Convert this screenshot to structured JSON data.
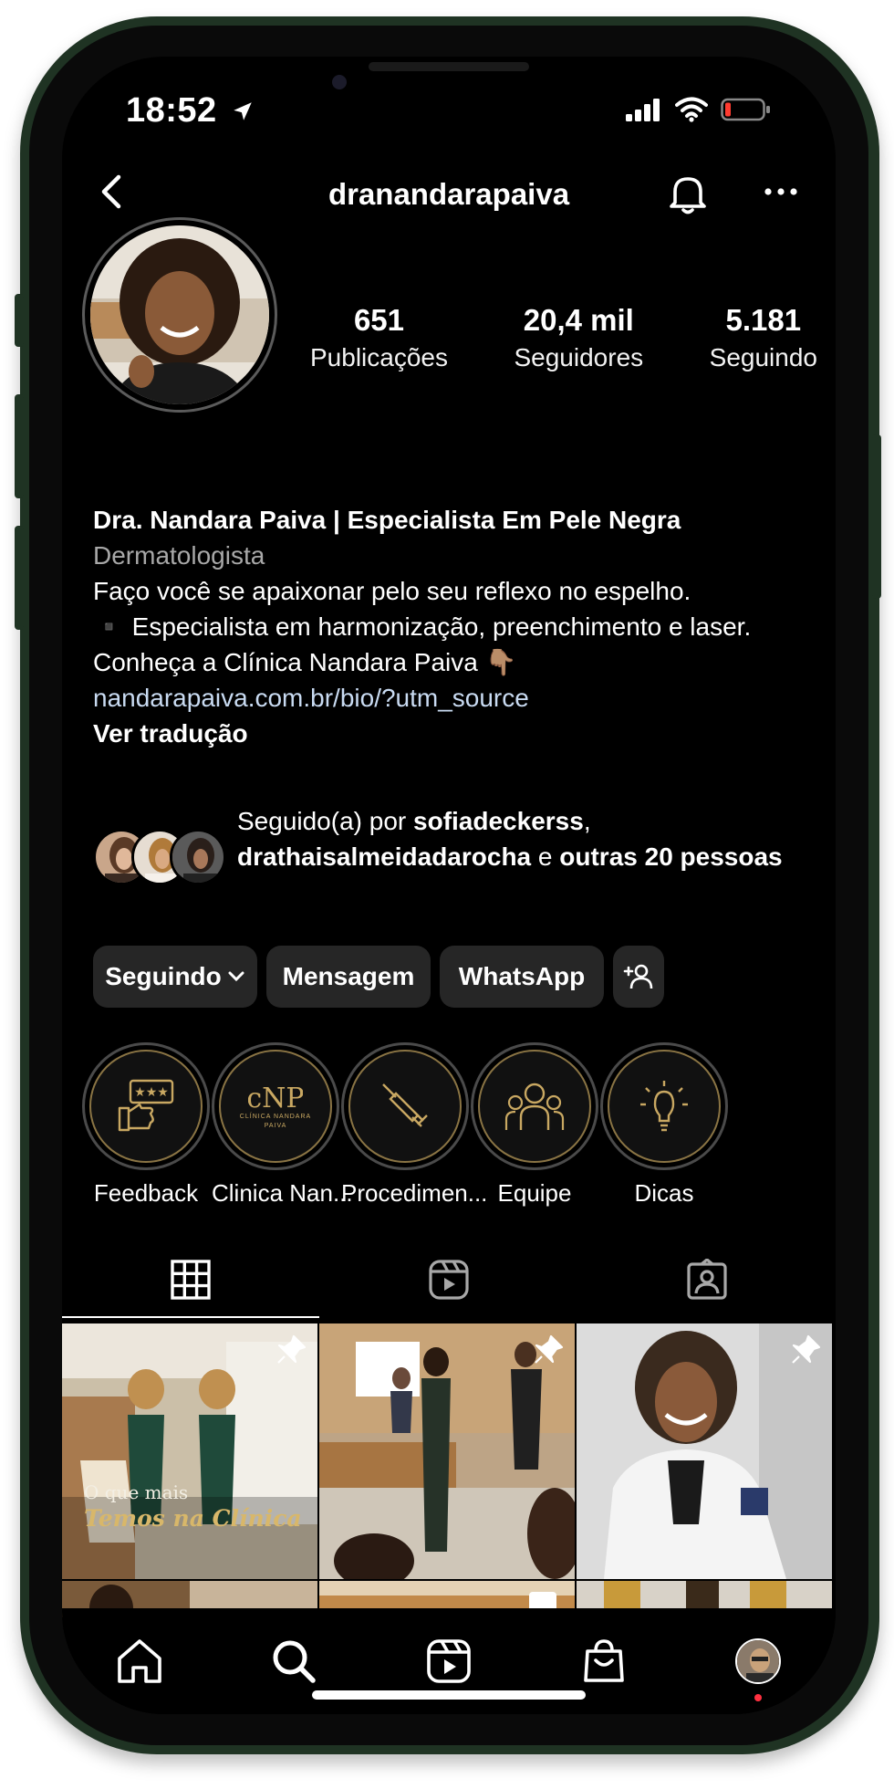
{
  "status_bar": {
    "time": "18:52"
  },
  "header": {
    "username": "dranandarapaiva"
  },
  "stats": [
    {
      "value": "651",
      "label": "Publicações"
    },
    {
      "value": "20,4 mil",
      "label": "Seguidores"
    },
    {
      "value": "5.181",
      "label": "Seguindo"
    }
  ],
  "bio": {
    "name": "Dra. Nandara Paiva | Especialista Em Pele Negra",
    "category": "Dermatologista",
    "line1": "Faço você se apaixonar pelo seu reflexo no espelho.",
    "line2": "▪️ Especialista em harmonização, preenchimento e laser.",
    "line3": "Conheça a Clínica Nandara Paiva 👇🏽",
    "link": "nandarapaiva.com.br/bio/?utm_source",
    "translate": "Ver tradução"
  },
  "followed_by": {
    "prefix": "Seguido(a) por ",
    "user1": "sofiadeckerss",
    "sep": ",",
    "user2": "drathaisalmeidadarocha",
    "connector": " e ",
    "others": "outras 20 pessoas"
  },
  "actions": {
    "following": "Seguindo",
    "message": "Mensagem",
    "whatsapp": "WhatsApp"
  },
  "highlights": [
    {
      "label": "Feedback",
      "icon": "feedback-icon"
    },
    {
      "label": "Clinica Nan...",
      "icon": "clinic-logo-icon"
    },
    {
      "label": "Procedimen...",
      "icon": "syringe-icon"
    },
    {
      "label": "Equipe",
      "icon": "team-icon"
    },
    {
      "label": "Dicas",
      "icon": "lightbulb-icon"
    }
  ],
  "clinic_logo_text": "CLÍNICA NANDARA PAIVA",
  "grid": {
    "post1_caption_line1": "O que mais",
    "post1_caption_line2": "Temos na Clínica"
  },
  "colors": {
    "background": "#000000",
    "button": "#262626",
    "link": "#c9dbf2",
    "gold": "#d8b76a",
    "notification_dot": "#ff3040",
    "frame": "#1f3323"
  }
}
